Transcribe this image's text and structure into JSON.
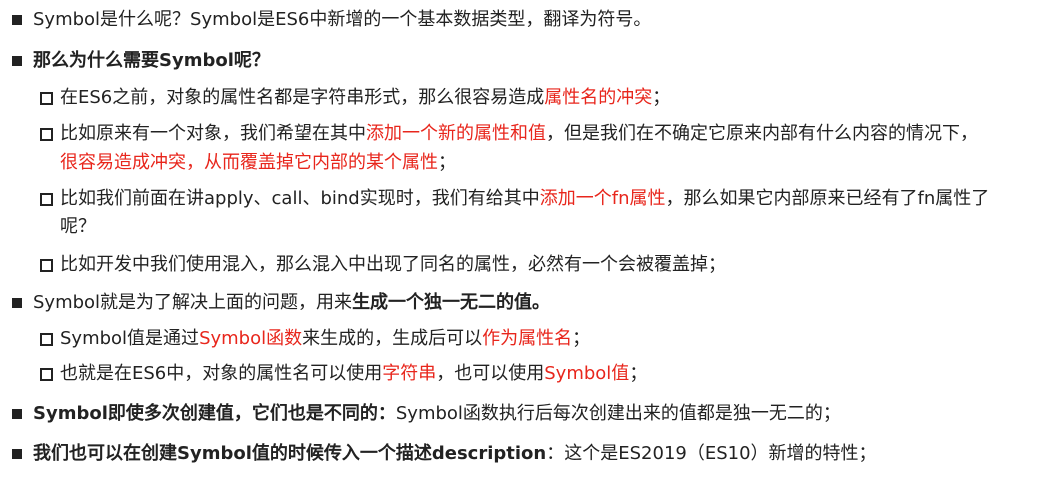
{
  "lines": [
    {
      "id": "l1",
      "segments": [
        "Symbol是什么呢？Symbol是ES6中新增的一个基本数据类型，翻译为符号。"
      ]
    },
    {
      "id": "l2",
      "segments": [
        "那么为什么需要Symbol呢？"
      ]
    },
    {
      "id": "l3",
      "segments": [
        "在ES6之前，对象的属性名都是字符串形式，那么很容易造成",
        "属性名的冲突",
        "；"
      ]
    },
    {
      "id": "l4a",
      "segments": [
        "比如原来有一个对象，我们希望在其中",
        "添加一个新的属性和值",
        "，但是我们在不确定它原来内部有什么内容的情况下，"
      ]
    },
    {
      "id": "l4b",
      "segments": [
        "很容易造成冲突，从而覆盖掉它内部的某个属性",
        "；"
      ]
    },
    {
      "id": "l5a",
      "segments": [
        "比如我们前面在讲apply、call、bind实现时，我们有给其中",
        "添加一个fn属性",
        "，那么如果它内部原来已经有了fn属性了"
      ]
    },
    {
      "id": "l5b",
      "segments": [
        "呢？"
      ]
    },
    {
      "id": "l6",
      "segments": [
        "比如开发中我们使用混入，那么混入中出现了同名的属性，必然有一个会被覆盖掉；"
      ]
    },
    {
      "id": "l7",
      "segments": [
        "Symbol就是为了解决上面的问题，用来",
        "生成一个独一无二的值。"
      ]
    },
    {
      "id": "l8",
      "segments": [
        "Symbol值是通过",
        "Symbol函数",
        "来生成的，生成后可以",
        "作为属性名",
        "；"
      ]
    },
    {
      "id": "l9",
      "segments": [
        "也就是在ES6中，对象的属性名可以使用",
        "字符串",
        "，也可以使用",
        "Symbol值",
        "；"
      ]
    },
    {
      "id": "l10",
      "segments": [
        "Symbol即使多次创建值，它们也是不同的：",
        "Symbol函数执行后每次创建出来的值都是独一无二的；"
      ]
    },
    {
      "id": "l11",
      "segments": [
        "我们也可以在创建Symbol值的时候传入一个描述description",
        "：这个是ES2019（ES10）新增的特性；"
      ]
    }
  ],
  "colors": {
    "text": "#222222",
    "highlight": "#e8261c",
    "background": "#ffffff"
  }
}
